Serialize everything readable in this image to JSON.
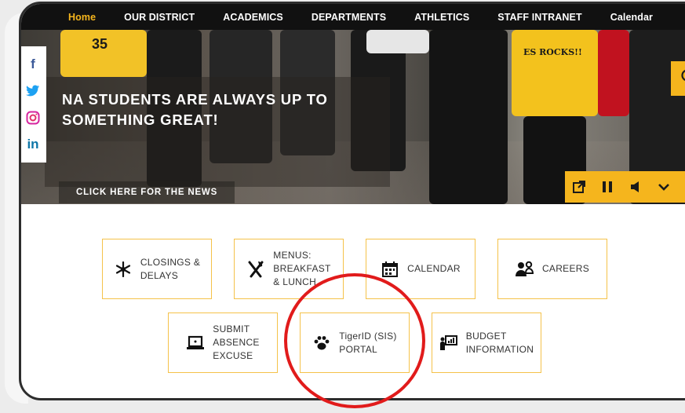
{
  "nav": {
    "items": [
      "Home",
      "OUR DISTRICT",
      "ACADEMICS",
      "DEPARTMENTS",
      "ATHLETICS",
      "STAFF INTRANET",
      "Calendar"
    ],
    "active": "Home"
  },
  "hero": {
    "title_line1": "NA STUDENTS ARE ALWAYS UP TO",
    "title_line2": "SOMETHING GREAT!",
    "cta": "CLICK HERE FOR THE NEWS",
    "shirt_text": "ES ROCKS!!",
    "jersey_number": "35"
  },
  "social": {
    "icons": [
      "facebook-icon",
      "twitter-icon",
      "instagram-icon",
      "linkedin-icon"
    ],
    "glyphs": [
      "f",
      "t",
      "o",
      "n"
    ]
  },
  "controls": {
    "icons": [
      "external-link-icon",
      "pause-icon",
      "volume-icon",
      "chevron-down-icon"
    ]
  },
  "tiles": {
    "closings": {
      "label1": "CLOSINGS &",
      "label2": "DELAYS",
      "icon": "snowflake-icon"
    },
    "menus": {
      "label1": "MENUS:",
      "label2": "BREAKFAST",
      "label3": "& LUNCH",
      "icon": "fork-knife-icon"
    },
    "calendar": {
      "label1": "CALENDAR",
      "icon": "calendar-icon"
    },
    "careers": {
      "label1": "CAREERS",
      "icon": "people-icon"
    },
    "absence": {
      "label1": "SUBMIT",
      "label2": "ABSENCE",
      "label3": "EXCUSE",
      "icon": "laptop-icon"
    },
    "tigerid": {
      "label1": "TigerID (SIS)",
      "label2": "PORTAL",
      "icon": "paw-icon"
    },
    "budget": {
      "label1": "BUDGET",
      "label2": "INFORMATION",
      "icon": "presentation-icon"
    }
  },
  "colors": {
    "accent": "#f5b51d",
    "nav_bg": "#111111",
    "highlight_circle": "#e11b1b",
    "tile_border": "#f5c24a"
  }
}
